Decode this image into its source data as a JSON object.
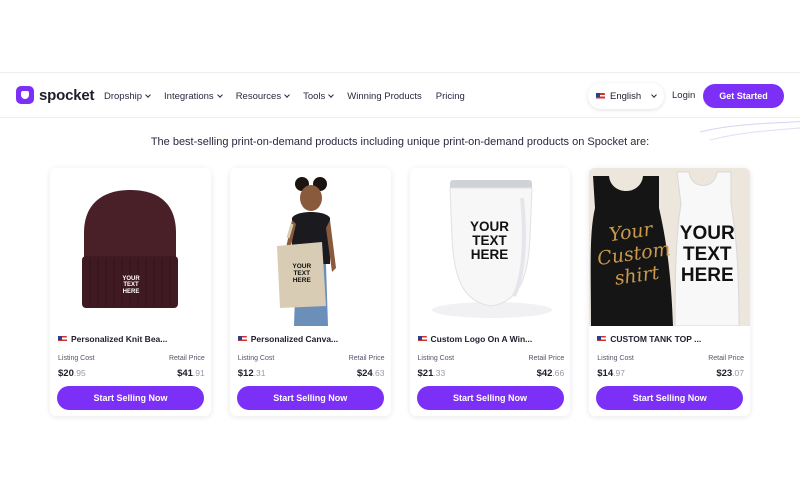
{
  "nav": {
    "logo_text": "spocket",
    "menu": [
      {
        "label": "Dropship",
        "has_dropdown": true
      },
      {
        "label": "Integrations",
        "has_dropdown": true
      },
      {
        "label": "Resources",
        "has_dropdown": true
      },
      {
        "label": "Tools",
        "has_dropdown": true
      },
      {
        "label": "Winning Products",
        "has_dropdown": false
      },
      {
        "label": "Pricing",
        "has_dropdown": false
      }
    ],
    "language": "English",
    "login": "Login",
    "cta": "Get Started"
  },
  "section": {
    "subtitle": "The best-selling print-on-demand products including unique print-on-demand products on Spocket are:"
  },
  "products": [
    {
      "name": "Personalized Knit Bea...",
      "listing_label": "Listing Cost",
      "retail_label": "Retail Price",
      "listing_main": "$20",
      "listing_cents": ".95",
      "retail_main": "$41",
      "retail_cents": ".91",
      "button": "Start Selling Now",
      "image_text": "YOUR TEXT HERE"
    },
    {
      "name": "Personalized Canva...",
      "listing_label": "Listing Cost",
      "retail_label": "Retail Price",
      "listing_main": "$12",
      "listing_cents": ".31",
      "retail_main": "$24",
      "retail_cents": ".63",
      "button": "Start Selling Now",
      "image_text": "YOUR TEXT HERE"
    },
    {
      "name": "Custom Logo On A Win...",
      "listing_label": "Listing Cost",
      "retail_label": "Retail Price",
      "listing_main": "$21",
      "listing_cents": ".33",
      "retail_main": "$42",
      "retail_cents": ".66",
      "button": "Start Selling Now",
      "image_text": "YOUR TEXT HERE"
    },
    {
      "name": "CUSTOM TANK TOP ...",
      "listing_label": "Listing Cost",
      "retail_label": "Retail Price",
      "listing_main": "$14",
      "listing_cents": ".97",
      "retail_main": "$23",
      "retail_cents": ".07",
      "button": "Start Selling Now",
      "image_text": "YOUR TEXT HERE",
      "image_script": "Your Custom shirt"
    }
  ],
  "colors": {
    "accent": "#7b2ff7",
    "text": "#1f1d2b"
  },
  "icons": {
    "flag": "us-flag-icon",
    "chevron": "chevron-down-icon",
    "logo": "spocket-logo-icon"
  }
}
